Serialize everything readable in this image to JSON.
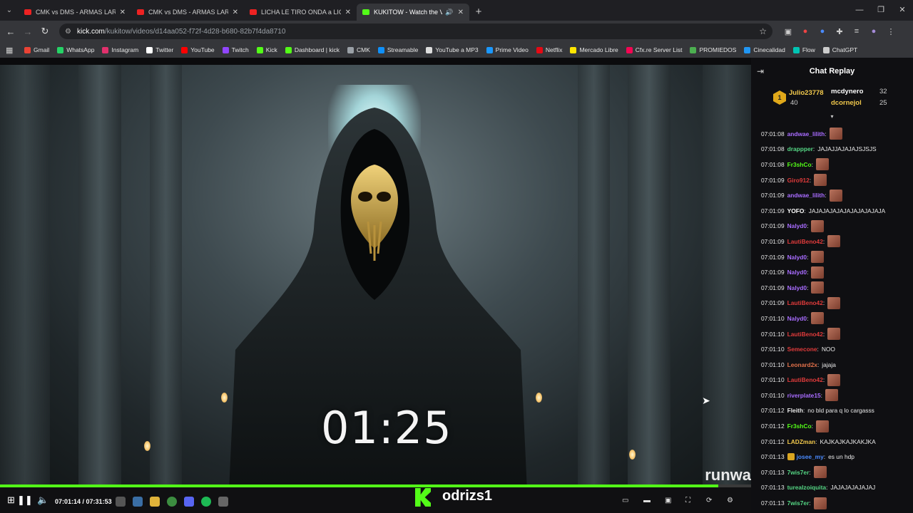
{
  "tabs": [
    {
      "label": "CMK vs DMS - ARMAS LARGAS",
      "active": false
    },
    {
      "label": "CMK vs DMS - ARMAS LARGAS",
      "active": false
    },
    {
      "label": "LICHA LE TIRO ONDA a LICY y",
      "active": false
    },
    {
      "label": "KUKITOW - Watch the VOD",
      "active": true
    }
  ],
  "address": {
    "host": "kick.com",
    "path": "/kukitow/videos/d14aa052-f72f-4d28-b680-82b7f4da8710"
  },
  "bookmarks": [
    {
      "label": "Gmail",
      "color": "#ea4335"
    },
    {
      "label": "WhatsApp",
      "color": "#25d366"
    },
    {
      "label": "Instagram",
      "color": "#e1306c"
    },
    {
      "label": "Twitter",
      "color": "#ffffff"
    },
    {
      "label": "YouTube",
      "color": "#ff0000"
    },
    {
      "label": "Twitch",
      "color": "#9146ff"
    },
    {
      "label": "Kick",
      "color": "#53fc18"
    },
    {
      "label": "Dashboard | kick",
      "color": "#53fc18"
    },
    {
      "label": "CMK",
      "color": "#9aa0a6"
    },
    {
      "label": "Streamable",
      "color": "#0f90fa"
    },
    {
      "label": "YouTube a MP3",
      "color": "#dddddd"
    },
    {
      "label": "Prime Video",
      "color": "#1a98ff"
    },
    {
      "label": "Netflix",
      "color": "#e50914"
    },
    {
      "label": "Mercado Libre",
      "color": "#ffe600"
    },
    {
      "label": "Cfx.re Server List",
      "color": "#f40552"
    },
    {
      "label": "PROMIEDOS",
      "color": "#4caf50"
    },
    {
      "label": "Cinecalidad",
      "color": "#2196f3"
    },
    {
      "label": "Flow",
      "color": "#00c4b3"
    },
    {
      "label": "ChatGPT",
      "color": "#cccccc"
    }
  ],
  "video": {
    "timer": "01:25",
    "watermark": "runwa"
  },
  "chat": {
    "title": "Chat Replay",
    "leaders": [
      {
        "rank": "1",
        "name": "Julio23778",
        "count": "40"
      },
      {
        "name": "mcdynero",
        "count": "32"
      },
      {
        "name": "dcornejol",
        "count": "25"
      }
    ],
    "messages": [
      {
        "ts": "07:01:08",
        "user": "andwae_lilith",
        "color": "#a86cff",
        "text": "",
        "emote": true
      },
      {
        "ts": "07:01:08",
        "user": "drappper",
        "color": "#55d684",
        "text": "JAJAJJAJAJAJSJSJS",
        "emote": false
      },
      {
        "ts": "07:01:08",
        "user": "Fr3shCo",
        "color": "#53fc18",
        "text": "",
        "emote": true
      },
      {
        "ts": "07:01:09",
        "user": "Giro912",
        "color": "#e03b3b",
        "text": "",
        "emote": true
      },
      {
        "ts": "07:01:09",
        "user": "andwae_lilith",
        "color": "#a86cff",
        "text": "",
        "emote": true
      },
      {
        "ts": "07:01:09",
        "user": "YOFO",
        "color": "#ffffff",
        "text": "JAJAJAJAJAJAJAJAJAJAJA",
        "emote": false
      },
      {
        "ts": "07:01:09",
        "user": "Nalyd0",
        "color": "#a86cff",
        "text": "",
        "emote": true
      },
      {
        "ts": "07:01:09",
        "user": "LautiBeno42",
        "color": "#e03b3b",
        "text": "",
        "emote": true
      },
      {
        "ts": "07:01:09",
        "user": "Nalyd0",
        "color": "#a86cff",
        "text": "",
        "emote": true
      },
      {
        "ts": "07:01:09",
        "user": "Nalyd0",
        "color": "#a86cff",
        "text": "",
        "emote": true
      },
      {
        "ts": "07:01:09",
        "user": "Nalyd0",
        "color": "#a86cff",
        "text": "",
        "emote": true
      },
      {
        "ts": "07:01:09",
        "user": "LautiBeno42",
        "color": "#e03b3b",
        "text": "",
        "emote": true
      },
      {
        "ts": "07:01:10",
        "user": "Nalyd0",
        "color": "#a86cff",
        "text": "",
        "emote": true
      },
      {
        "ts": "07:01:10",
        "user": "LautiBeno42",
        "color": "#e03b3b",
        "text": "",
        "emote": true
      },
      {
        "ts": "07:01:10",
        "user": "Semecone",
        "color": "#e03b3b",
        "text": "NOO",
        "emote": false
      },
      {
        "ts": "07:01:10",
        "user": "Leonard2x",
        "color": "#e0704a",
        "text": "jajaja",
        "emote": false
      },
      {
        "ts": "07:01:10",
        "user": "LautiBeno42",
        "color": "#e03b3b",
        "text": "",
        "emote": true
      },
      {
        "ts": "07:01:10",
        "user": "riverplate15",
        "color": "#a86cff",
        "text": "",
        "emote": true
      },
      {
        "ts": "07:01:12",
        "user": "Fleith",
        "color": "#e8e8e8",
        "text": "no bld para q lo cargasss",
        "emote": false
      },
      {
        "ts": "07:01:12",
        "user": "Fr3shCo",
        "color": "#53fc18",
        "text": "",
        "emote": true
      },
      {
        "ts": "07:01:12",
        "user": "LADZman",
        "color": "#f2c94c",
        "text": "KAJKAJKAJKAKJKA",
        "emote": false
      },
      {
        "ts": "07:01:13",
        "user": "josee_my",
        "color": "#4a8bff",
        "text": "es un hdp",
        "emote": false,
        "badge": true
      },
      {
        "ts": "07:01:13",
        "user": "7wis7er",
        "color": "#55d684",
        "text": "",
        "emote": true
      },
      {
        "ts": "07:01:13",
        "user": "turealzoiquita",
        "color": "#55d684",
        "text": "JAJAJAJAJAJAJ",
        "emote": false
      },
      {
        "ts": "07:01:13",
        "user": "7wis7er",
        "color": "#55d684",
        "text": "",
        "emote": true
      }
    ]
  },
  "player": {
    "current": "07:01:14",
    "total": "07:31:53",
    "progress": 0.956,
    "overlay_name": "odrizs1"
  },
  "accent": "#53fc18"
}
